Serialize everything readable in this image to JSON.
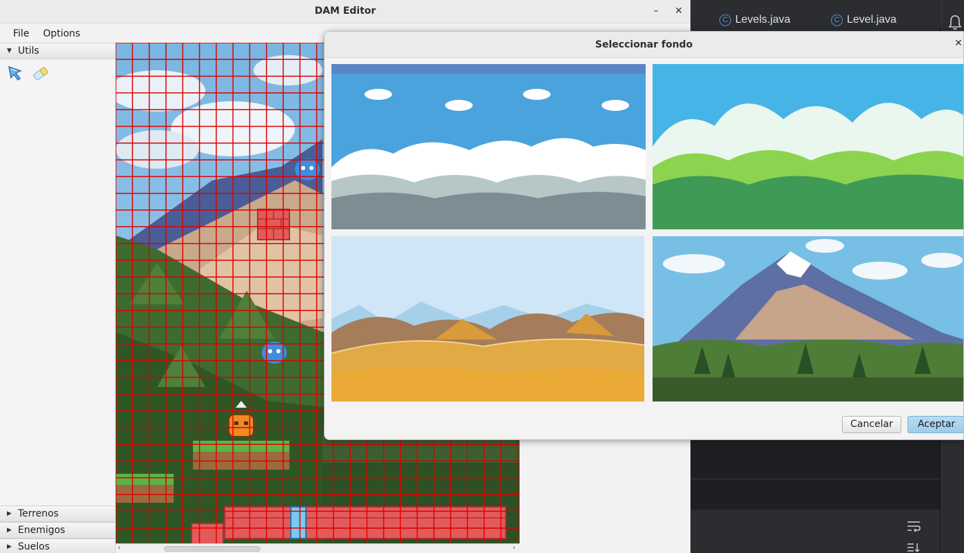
{
  "window": {
    "title": "DAM Editor",
    "minimize_glyph": "–",
    "close_glyph": "✕"
  },
  "menu": {
    "file": "File",
    "options": "Options"
  },
  "left_panel": {
    "sections": [
      {
        "label": "Utils",
        "expanded": true
      },
      {
        "label": "Terrenos",
        "expanded": false
      },
      {
        "label": "Enemigos",
        "expanded": false
      },
      {
        "label": "Suelos",
        "expanded": false
      }
    ],
    "tools": [
      "cursor-icon",
      "eraser-icon"
    ]
  },
  "ide": {
    "tabs": [
      "Levels.java",
      "Level.java"
    ],
    "tab_icon_glyph": "C"
  },
  "dialog": {
    "title": "Seleccionar fondo",
    "close_glyph": "✕",
    "backgrounds": [
      {
        "name": "sky-clouds-mountains-background"
      },
      {
        "name": "green-hills-background"
      },
      {
        "name": "desert-dunes-background"
      },
      {
        "name": "snowy-mountain-forest-background"
      }
    ],
    "cancel_label": "Cancelar",
    "ok_label": "Aceptar"
  },
  "colors": {
    "grid_line": "#e00000",
    "ok_button": "#a6d3ee",
    "ide_bg": "#2b2d30",
    "ide_tab_icon": "#4a8fe7"
  }
}
